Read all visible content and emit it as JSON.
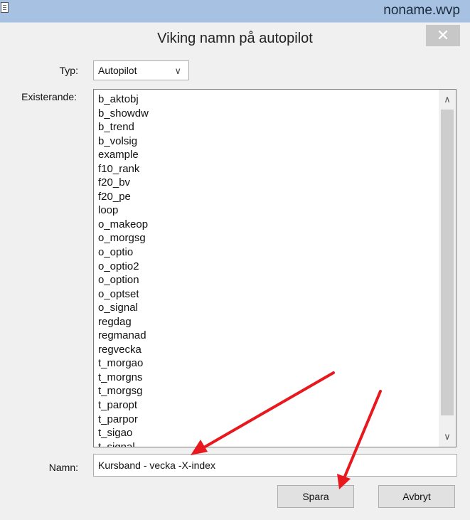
{
  "app": {
    "title": "noname.wvp",
    "icon": "document-icon"
  },
  "dialog": {
    "title": "Viking namn på autopilot",
    "close_label": "✕",
    "type_label": "Typ:",
    "type_value": "Autopilot",
    "existing_label": "Existerande:",
    "items": [
      "b_aktobj",
      "b_showdw",
      "b_trend",
      "b_volsig",
      "example",
      "f10_rank",
      "f20_bv",
      "f20_pe",
      "loop",
      "o_makeop",
      "o_morgsg",
      "o_optio",
      "o_optio2",
      "o_option",
      "o_optset",
      "o_signal",
      "regdag",
      "regmanad",
      "regvecka",
      "t_morgao",
      "t_morgns",
      "t_morgsg",
      "t_paropt",
      "t_parpor",
      "t_sigao",
      "t_signal"
    ],
    "name_label": "Namn:",
    "name_value": "Kursband - vecka -X-index",
    "save_label": "Spara",
    "cancel_label": "Avbryt"
  },
  "colors": {
    "app_bar": "#a7c1e3",
    "close_button": "#c7c7c7",
    "annotation_arrow": "#e8191e"
  }
}
